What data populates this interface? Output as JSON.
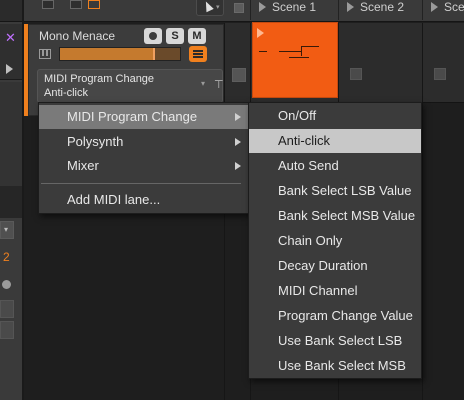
{
  "toolbar": {
    "scenes": [
      {
        "label": "Scene 1"
      },
      {
        "label": "Scene 2"
      },
      {
        "label": "Sce"
      }
    ]
  },
  "left_strip": {
    "number": "2"
  },
  "track": {
    "name": "Mono Menace",
    "solo_label": "S",
    "mute_label": "M",
    "volume_level": 0.78,
    "color": "#f0801e",
    "lane_selector": {
      "parameter": "MIDI Program Change",
      "value": "Anti-click"
    }
  },
  "clip": {
    "color": "#f25c13"
  },
  "context_menu": {
    "items": [
      {
        "label": "MIDI Program Change",
        "has_submenu": true,
        "highlighted": true
      },
      {
        "label": "Polysynth",
        "has_submenu": true,
        "highlighted": false
      },
      {
        "label": "Mixer",
        "has_submenu": true,
        "highlighted": false
      },
      {
        "label": "Add MIDI lane...",
        "has_submenu": false,
        "highlighted": false
      }
    ]
  },
  "submenu": {
    "items": [
      {
        "label": "On/Off"
      },
      {
        "label": "Anti-click",
        "highlighted": true
      },
      {
        "label": "Auto Send"
      },
      {
        "label": "Bank Select LSB Value"
      },
      {
        "label": "Bank Select MSB Value"
      },
      {
        "label": "Chain Only"
      },
      {
        "label": "Decay Duration"
      },
      {
        "label": "MIDI Channel"
      },
      {
        "label": "Program Change Value"
      },
      {
        "label": "Use Bank Select LSB"
      },
      {
        "label": "Use Bank Select MSB"
      }
    ]
  }
}
